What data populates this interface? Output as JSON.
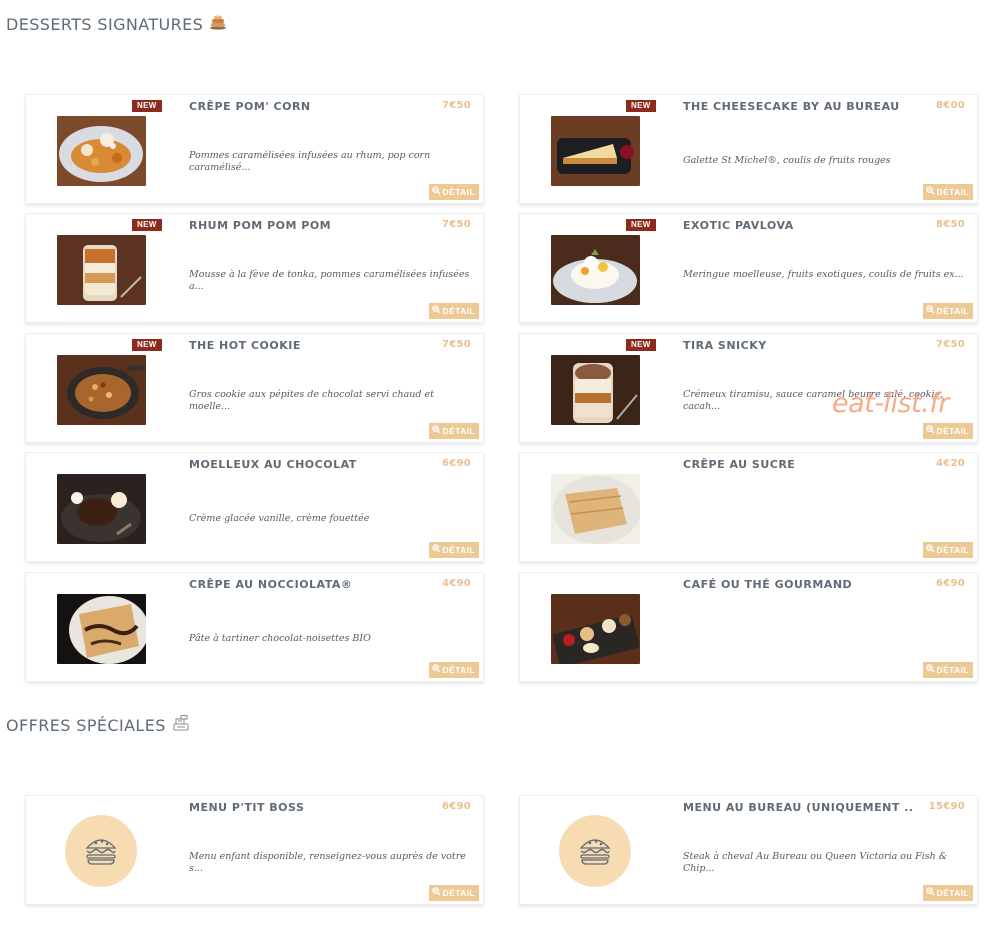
{
  "sections": {
    "desserts_title": "DESSERTS SIGNATURES",
    "desserts_icon": "pancake-stack-icon",
    "offers_title": "OFFRES SPÉCIALES",
    "offers_icon": "cash-register-icon"
  },
  "detail_label": "DÉTAIL",
  "badge_label": "NEW",
  "watermark": "eat-list.fr",
  "desserts": [
    {
      "name": "CRÊPE POM' CORN",
      "price": "7€50",
      "badge": true,
      "desc": "Pommes caramélisées infusées au rhum, pop corn caramélisé...",
      "image": "crepe-pomcorn"
    },
    {
      "name": "THE CHEESECAKE BY AU BUREAU",
      "price": "8€00",
      "badge": true,
      "desc": "Galette St Michel®, coulis de fruits rouges",
      "image": "cheesecake"
    },
    {
      "name": "RHUM POM POM POM",
      "price": "7€50",
      "badge": true,
      "desc": "Mousse à la fève de tonka, pommes caramélisées infusées a...",
      "image": "rhum-verrine"
    },
    {
      "name": "EXOTIC PAVLOVA",
      "price": "8€50",
      "badge": true,
      "desc": "Meringue moelleuse, fruits exotiques, coulis de fruits ex...",
      "image": "pavlova"
    },
    {
      "name": "THE HOT COOKIE",
      "price": "7€50",
      "badge": true,
      "desc": "Gros cookie aux pépites de chocolat servi chaud et moelle...",
      "image": "hot-cookie"
    },
    {
      "name": "TIRA SNICKY",
      "price": "7€50",
      "badge": true,
      "desc": "Crémeux tiramisu, sauce caramel beurre salé, cookie, cacah...",
      "image": "tira-snicky"
    },
    {
      "name": "MOELLEUX AU CHOCOLAT",
      "price": "6€90",
      "badge": false,
      "desc": "Crème glacée vanille, crème fouettée",
      "image": "moelleux"
    },
    {
      "name": "CRÊPE AU SUCRE",
      "price": "4€20",
      "badge": false,
      "desc": "",
      "image": "crepe-sucre"
    },
    {
      "name": "CRÊPE AU NOCCIOLATA®",
      "price": "4€90",
      "badge": false,
      "desc": "Pâte à tartiner chocolat-noisettes BIO",
      "image": "crepe-nocciolata"
    },
    {
      "name": "CAFÉ OU THÉ GOURMAND",
      "price": "6€90",
      "badge": false,
      "desc": "",
      "image": "cafe-gourmand"
    }
  ],
  "offers": [
    {
      "name": "MENU P'TIT BOSS",
      "price": "6€90",
      "desc": "Menu enfant disponible, renseignez-vous auprès de votre s...",
      "image": "burger-icon"
    },
    {
      "name": "MENU AU BUREAU (UNIQUEMENT ...",
      "price": "15€90",
      "desc": "Steak à cheval Au Bureau ou Queen Victoria ou Fish & Chip...",
      "image": "burger-icon"
    }
  ],
  "colors": {
    "badge": "#8c2a1e",
    "price": "#e8c08f",
    "detail_button": "#ecc995",
    "burger_circle": "#f6dcb0",
    "title": "#5f6b76"
  }
}
